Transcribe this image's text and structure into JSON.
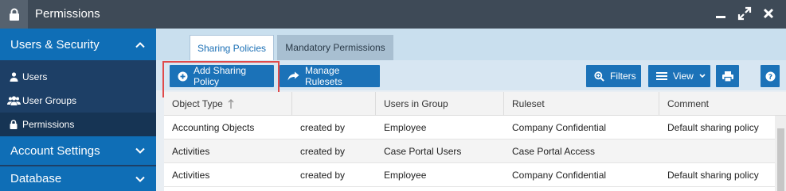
{
  "window": {
    "title": "Permissions",
    "icons": [
      "lock-icon",
      "minimize-icon",
      "maximize-icon",
      "close-icon"
    ]
  },
  "sidebar": {
    "sections": [
      {
        "label": "Users & Security",
        "state": "expanded"
      },
      {
        "label": "Account Settings",
        "state": "collapsed"
      },
      {
        "label": "Database",
        "state": "collapsed"
      }
    ],
    "items": [
      {
        "label": "Users",
        "icon": "user-icon"
      },
      {
        "label": "User Groups",
        "icon": "user-group-icon"
      },
      {
        "label": "Permissions",
        "icon": "lock-icon",
        "active": true
      }
    ]
  },
  "tabs": [
    {
      "label": "Sharing Policies",
      "active": true
    },
    {
      "label": "Mandatory Permissions",
      "active": false
    }
  ],
  "toolbar": {
    "add_label": "Add Sharing Policy",
    "manage_label": "Manage Rulesets",
    "filters_label": "Filters",
    "view_label": "View"
  },
  "table": {
    "columns": [
      "Object Type",
      "",
      "Users in Group",
      "Ruleset",
      "Comment"
    ],
    "sort_column": "Object Type",
    "sort_direction": "ascending",
    "rows": [
      [
        "Accounting Objects",
        "created by",
        "Employee",
        "Company Confidential",
        "Default sharing policy"
      ],
      [
        "Activities",
        "created by",
        "Case Portal Users",
        "Case Portal Access",
        ""
      ],
      [
        "Activities",
        "created by",
        "Employee",
        "Company Confidential",
        "Default sharing policy"
      ]
    ]
  },
  "colors": {
    "titlebar": "#3e4a57",
    "sidebar_section": "#0f6eb6",
    "sidebar_bg": "#1d3f66",
    "button": "#1b72b8",
    "highlight": "#e04a4a"
  }
}
